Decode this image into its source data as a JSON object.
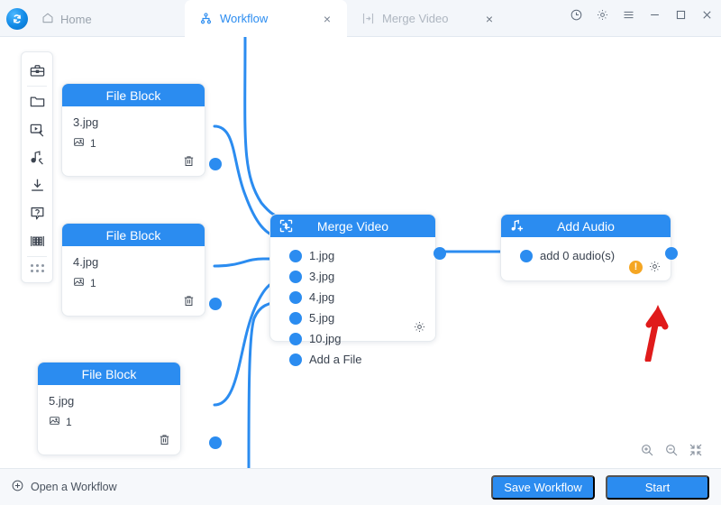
{
  "app": {
    "logo_icon": "app-logo-swirl-icon",
    "accent_color": "#2b8cf0",
    "warn_color": "#f5a623",
    "annotation_color": "#e01b1b"
  },
  "titlebar": {
    "home_label": "Home",
    "home_icon": "home-icon",
    "tabs": [
      {
        "label": "Workflow",
        "icon": "workflow-icon",
        "close": "×",
        "active": true
      },
      {
        "label": "Merge Video",
        "icon": "merge-video-icon",
        "close": "×",
        "active": false
      }
    ],
    "window_controls": [
      {
        "name": "history-icon"
      },
      {
        "name": "settings-gear-icon"
      },
      {
        "name": "menu-icon"
      },
      {
        "name": "minimize-icon"
      },
      {
        "name": "maximize-icon"
      },
      {
        "name": "close-icon"
      }
    ]
  },
  "toolpanel": {
    "items": [
      {
        "name": "toolbox-icon"
      },
      {
        "name": "folder-icon"
      },
      {
        "name": "video-tools-icon"
      },
      {
        "name": "audio-tools-icon"
      },
      {
        "name": "download-icon"
      },
      {
        "name": "help-icon"
      },
      {
        "name": "tracks-icon"
      },
      {
        "name": "drag-handle-icon"
      }
    ]
  },
  "canvas": {
    "file_blocks": [
      {
        "title": "File Block",
        "filename": "3.jpg",
        "count": "1"
      },
      {
        "title": "File Block",
        "filename": "4.jpg",
        "count": "1"
      },
      {
        "title": "File Block",
        "filename": "5.jpg",
        "count": "1"
      }
    ],
    "merge_node": {
      "title": "Merge Video",
      "icon": "merge-video-icon",
      "ports": [
        "1.jpg",
        "3.jpg",
        "4.jpg",
        "5.jpg",
        "10.jpg",
        "Add a File"
      ],
      "gear_icon": "gear-icon"
    },
    "audio_node": {
      "title": "Add Audio",
      "icon": "add-audio-icon",
      "port": "add 0 audio(s)",
      "warning_badge": "!",
      "gear_icon": "gear-icon"
    },
    "zoom_controls": [
      {
        "name": "zoom-in-icon"
      },
      {
        "name": "zoom-out-icon"
      },
      {
        "name": "fit-screen-icon"
      }
    ]
  },
  "bottombar": {
    "open_workflow_label": "Open a Workflow",
    "open_workflow_icon": "plus-circle-icon",
    "save_label": "Save Workflow",
    "start_label": "Start"
  }
}
